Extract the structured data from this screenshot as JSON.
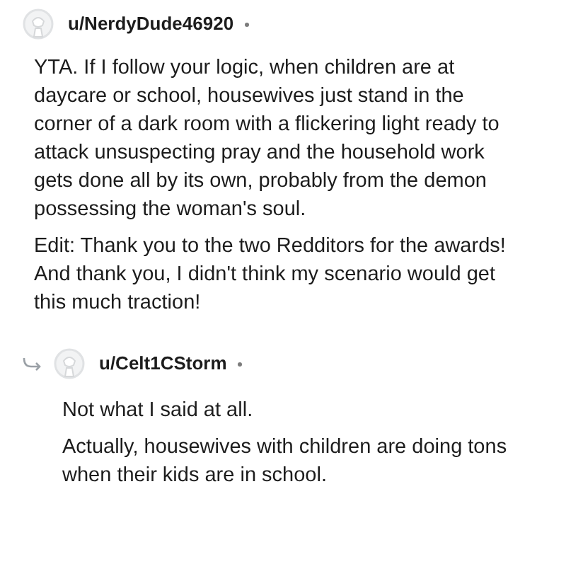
{
  "comments": [
    {
      "username": "u/NerdyDude46920",
      "is_reply": false,
      "paragraphs": [
        "YTA. If I follow your logic, when children are at daycare or school, housewives just stand in the corner of a dark room with a flickering light ready to attack unsuspecting pray and the household work gets done all by its own, probably from the demon possessing the woman's soul.",
        "Edit: Thank you to the two Redditors for the awards! And thank you, I didn't think my scenario would get this much traction!"
      ]
    },
    {
      "username": "u/Celt1CStorm",
      "is_reply": true,
      "paragraphs": [
        "Not what I said at all.",
        "Actually, housewives with children are doing tons when their kids are in school."
      ]
    }
  ]
}
